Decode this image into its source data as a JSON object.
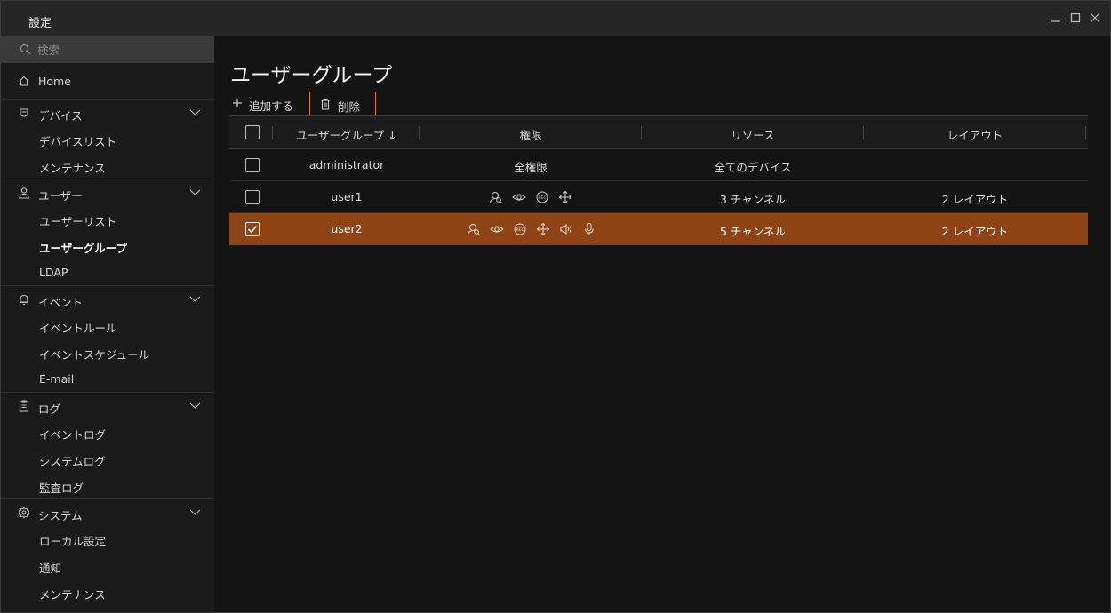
{
  "window": {
    "title": "設定",
    "controls": [
      "minimize-icon",
      "maximize-icon",
      "close-icon"
    ]
  },
  "sidebar": {
    "search": {
      "placeholder": "検索",
      "value": ""
    },
    "home": {
      "label": "Home",
      "icon": "home-icon"
    },
    "sections": [
      {
        "label": "デバイス",
        "icon": "device-icon",
        "items": [
          "デバイスリスト",
          "メンテナンス"
        ]
      },
      {
        "label": "ユーザー",
        "icon": "user-icon",
        "items": [
          "ユーザーリスト",
          "ユーザーグループ",
          "LDAP"
        ]
      },
      {
        "label": "イベント",
        "icon": "bell-icon",
        "items": [
          "イベントルール",
          "イベントスケジュール",
          "E-mail"
        ]
      },
      {
        "label": "ログ",
        "icon": "clipboard-icon",
        "items": [
          "イベントログ",
          "システムログ",
          "監査ログ"
        ]
      },
      {
        "label": "システム",
        "icon": "gear-icon",
        "items": [
          "ローカル設定",
          "通知",
          "メンテナンス"
        ]
      }
    ],
    "active_item": "ユーザーグループ"
  },
  "main": {
    "title": "ユーザーグループ",
    "toolbar": {
      "add_label": "追加する",
      "delete_label": "削除"
    },
    "table": {
      "columns": [
        "ユーザーグループ ↓",
        "権限",
        "リソース",
        "レイアウト"
      ],
      "rows": [
        {
          "checked": false,
          "group": "administrator",
          "permissions_text": "全権限",
          "permission_icons": [],
          "resource": "全てのデバイス",
          "layout": "",
          "selected": false
        },
        {
          "checked": false,
          "group": "user1",
          "permissions_text": "",
          "permission_icons": [
            "search-user-icon",
            "eye-icon",
            "rec-icon",
            "move-icon"
          ],
          "resource": "3 チャンネル",
          "layout": "2 レイアウト",
          "selected": false
        },
        {
          "checked": true,
          "group": "user2",
          "permissions_text": "",
          "permission_icons": [
            "search-user-icon",
            "eye-icon",
            "rec-icon",
            "move-icon",
            "speaker-icon",
            "microphone-icon"
          ],
          "resource": "5 チャンネル",
          "layout": "2 レイアウト",
          "selected": true
        }
      ]
    }
  },
  "colors": {
    "accent": "#e07b1f",
    "selected_row": "#8e4315",
    "background": "#141414",
    "sidebar": "#1a1a1a",
    "titlebar": "#262626"
  }
}
